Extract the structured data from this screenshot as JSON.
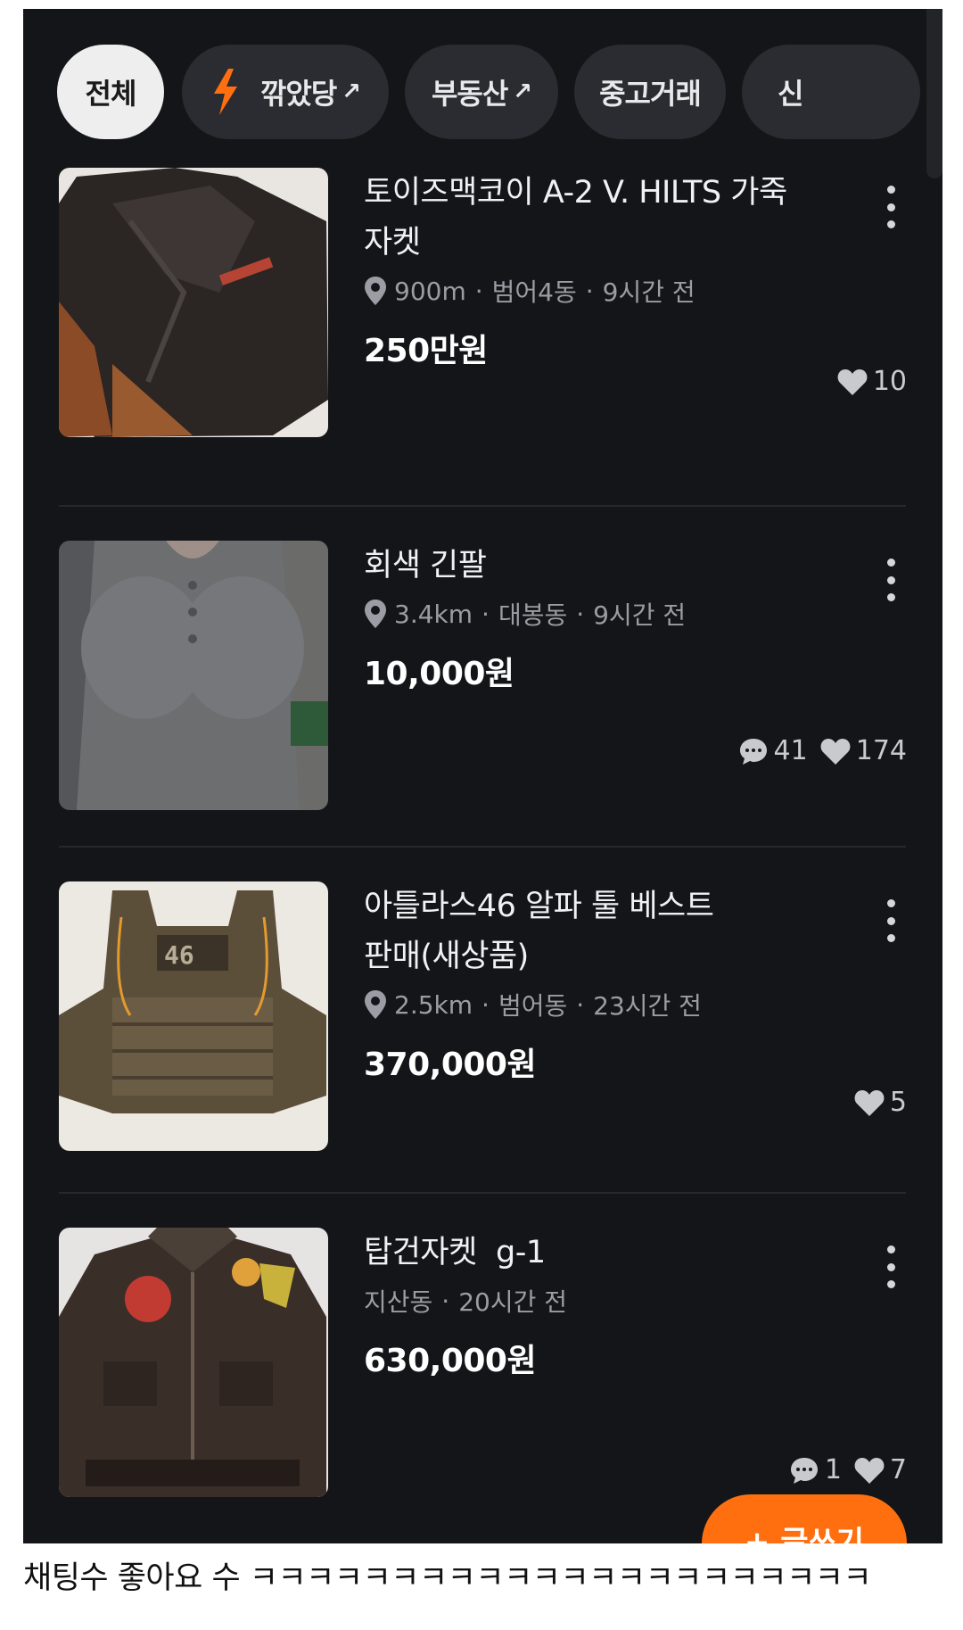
{
  "filter_chips": [
    {
      "label": "전체",
      "active": true
    },
    {
      "label": "깎았당",
      "external": true,
      "icon": "lightning-bolt-icon"
    },
    {
      "label": "부동산",
      "external": true
    },
    {
      "label": "중고거래"
    },
    {
      "label": "신"
    }
  ],
  "external_arrow": "↗",
  "listings": [
    {
      "title_line1": "토이즈맥코이 A-2 V. HILTS 가죽",
      "title_line2": "자켓",
      "distance": "900m",
      "location": "범어4동",
      "time": "9시간 전",
      "price": "250만원",
      "chats": "",
      "likes": "10",
      "image": "leather-jacket"
    },
    {
      "title_line1": "회색 긴팔",
      "title_line2": "",
      "distance": "3.4km",
      "location": "대봉동",
      "time": "9시간 전",
      "price": "10,000원",
      "chats": "41",
      "likes": "174",
      "image": "gray-long-sleeve"
    },
    {
      "title_line1": "아틀라스46 알파 툴 베스트",
      "title_line2": "판매(새상품)",
      "distance": "2.5km",
      "location": "범어동",
      "time": "23시간 전",
      "price": "370,000원",
      "chats": "",
      "likes": "5",
      "image": "tactical-vest"
    },
    {
      "title_line1": "탑건자켓  g-1",
      "title_line2": "",
      "distance": "",
      "location": "지산동",
      "time": "20시간 전",
      "price": "630,000원",
      "chats": "1",
      "likes": "7",
      "image": "g1-jacket"
    }
  ],
  "meta_separator": "·",
  "fab_label": "+ 글쓰기",
  "caption": "채팅수 좋아요 수 ㅋㅋㅋㅋㅋㅋㅋㅋㅋㅋㅋㅋㅋㅋㅋㅋㅋㅋㅋㅋㅋㅋ",
  "colors": {
    "background": "#141518",
    "chip": "#2a2c31",
    "chip_active": "#eeeeee",
    "accent": "#ff6f0f",
    "price": "#ffffff",
    "meta": "#9b9da4"
  }
}
